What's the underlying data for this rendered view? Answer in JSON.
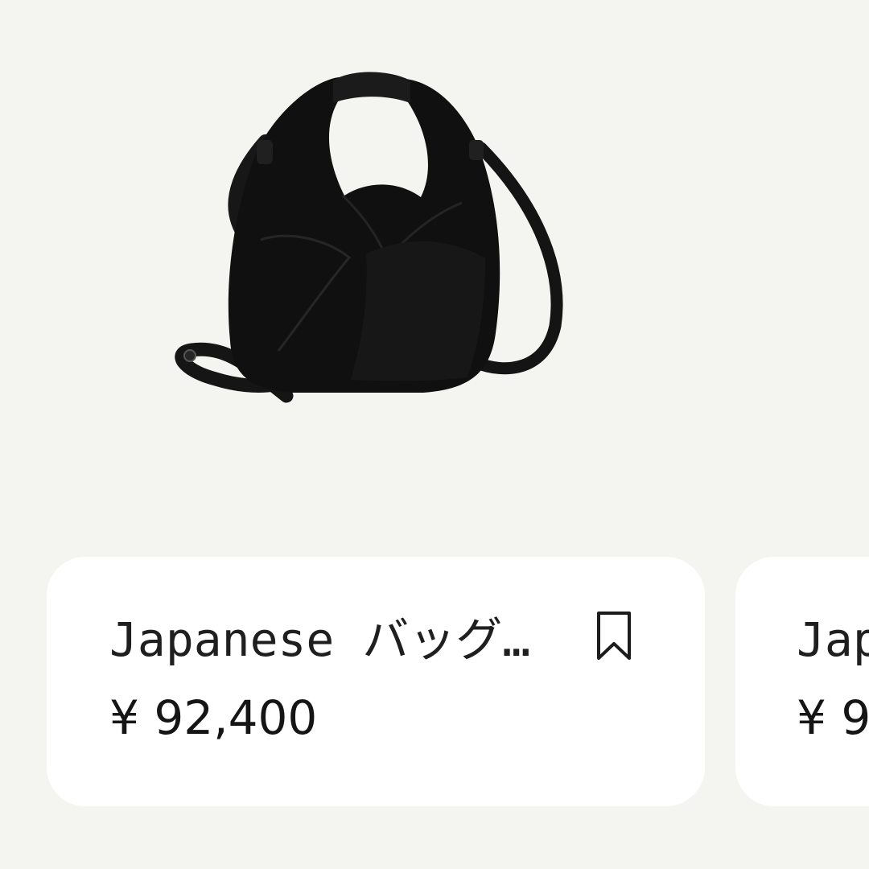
{
  "product_image": {
    "subject": "black leather handbag with crossbody strap"
  },
  "cards": [
    {
      "title": "Japanese バッグ…",
      "price": "¥ 92,400",
      "bookmark_icon": "bookmark-icon"
    },
    {
      "title": "Jap",
      "price": "¥ 9"
    }
  ],
  "colors": {
    "background": "#f4f5f0",
    "card": "#ffffff",
    "text": "#1f1f1f",
    "bag": "#121212"
  }
}
